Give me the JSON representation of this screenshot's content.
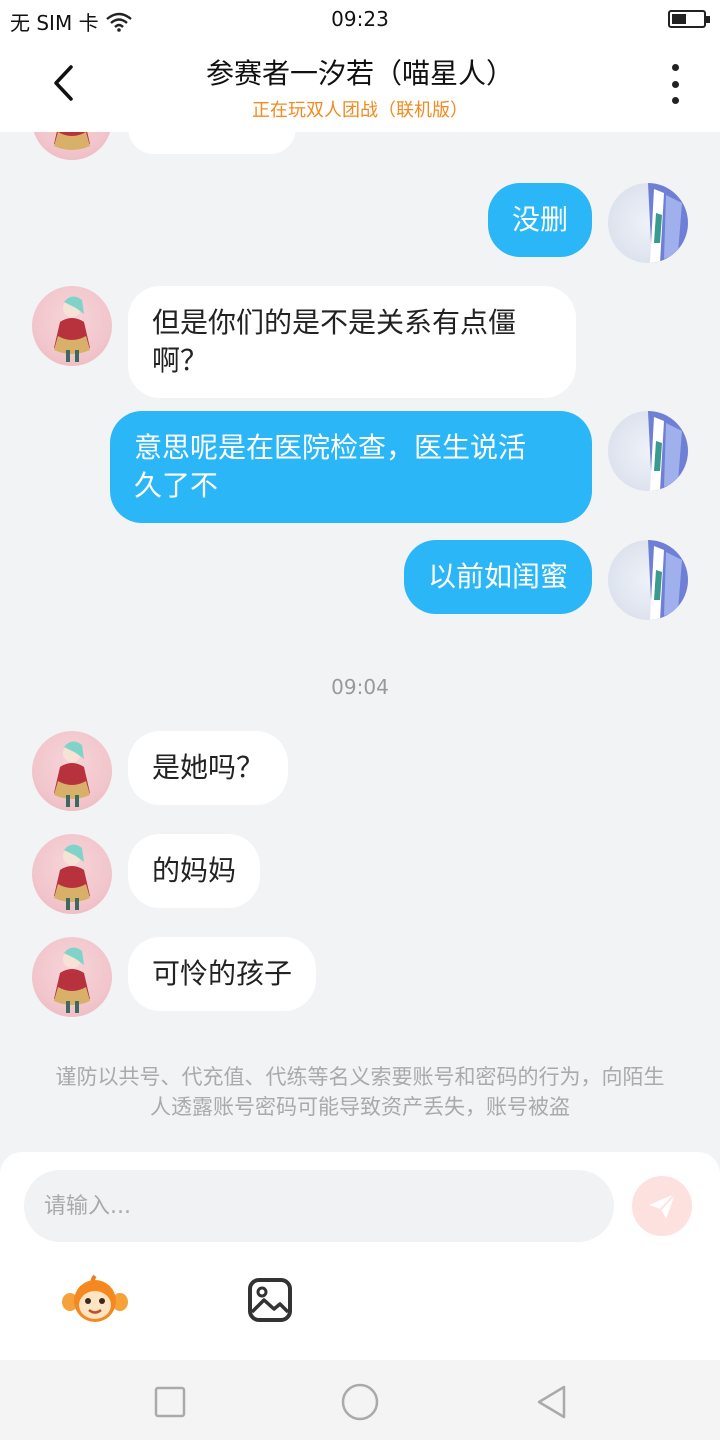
{
  "status": {
    "carrier": "无 SIM 卡",
    "time": "09:23"
  },
  "header": {
    "title": "参赛者一汐若（喵星人）",
    "subtitle": "正在玩双人团战（联机版）",
    "subtitle_color": "#f28a1f"
  },
  "chat": {
    "messages": [
      {
        "sender": "other",
        "text": ""
      },
      {
        "sender": "self",
        "text": "没删"
      },
      {
        "sender": "other",
        "text": "但是你们的是不是关系有点僵\n啊？"
      },
      {
        "sender": "self",
        "text": "意思呢是在医院检查，医生说活\n久了不"
      },
      {
        "sender": "self",
        "text": "以前如闺蜜"
      },
      {
        "sender": "other",
        "text": "是她吗？"
      },
      {
        "sender": "other",
        "text": "的妈妈"
      },
      {
        "sender": "other",
        "text": "可怜的孩子"
      }
    ],
    "timestamp": "09:04",
    "notice": "谨防以共号、代充值、代练等名义索要账号和密码的行为，向陌生人透露账号密码可能导致资产丢失，账号被盗",
    "bubble_out_color": "#2bb6f8",
    "bubble_in_color": "#ffffff"
  },
  "input": {
    "placeholder": "请输入...",
    "value": "",
    "send_icon": "paper-plane-icon",
    "emoji_icon": "monkey-face-icon",
    "image_icon": "image-icon"
  },
  "navbar": {
    "icons": [
      "square-icon",
      "circle-icon",
      "triangle-back-icon"
    ]
  }
}
